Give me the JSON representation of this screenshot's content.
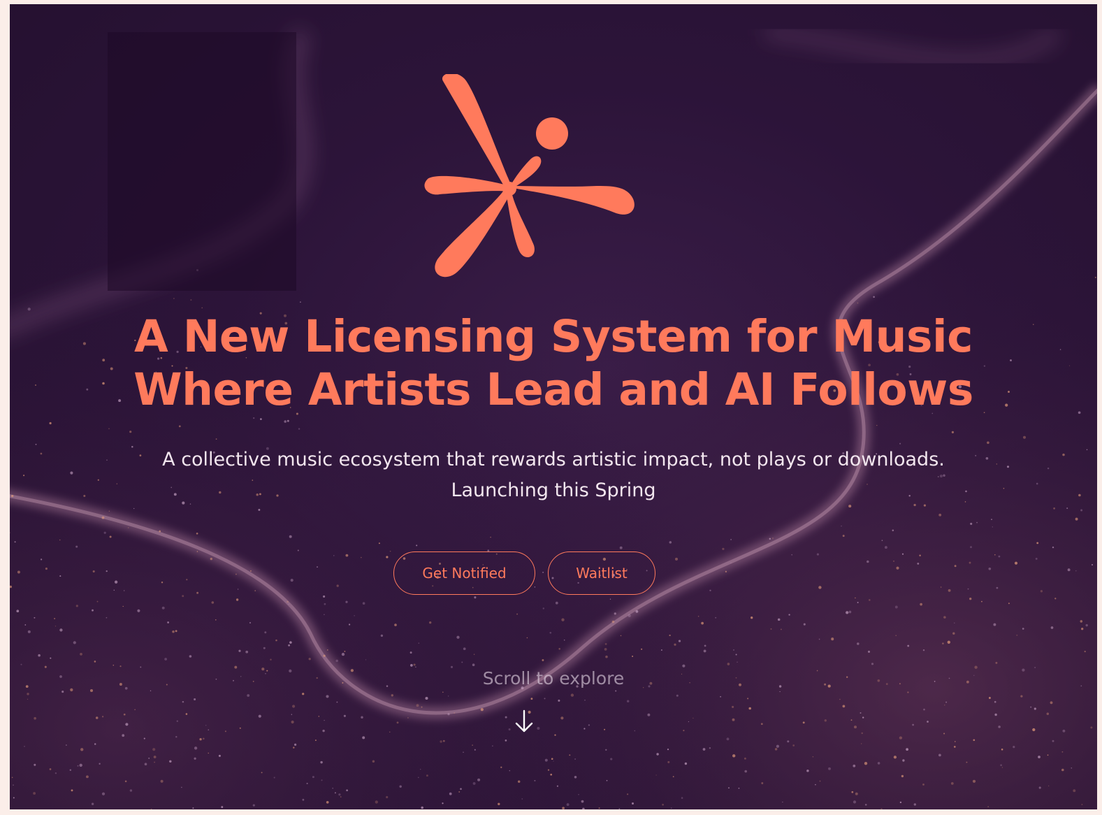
{
  "hero": {
    "headline_line1": "A New Licensing System for Music",
    "headline_line2": "Where Artists Lead and AI Follows",
    "subtitle_line1": "A collective music ecosystem that rewards artistic impact, not plays or downloads.",
    "subtitle_line2": "Launching this Spring"
  },
  "actions": {
    "get_notified_label": "Get Notified",
    "waitlist_label": "Waitlist"
  },
  "scroll": {
    "label": "Scroll to explore",
    "icon": "arrow-down-icon"
  },
  "logo": {
    "icon": "asterisk-logo-icon"
  },
  "colors": {
    "accent": "#ff7a5c",
    "background": "#2c1439",
    "text": "#f2e6ee",
    "page_border": "#fbeee9"
  }
}
